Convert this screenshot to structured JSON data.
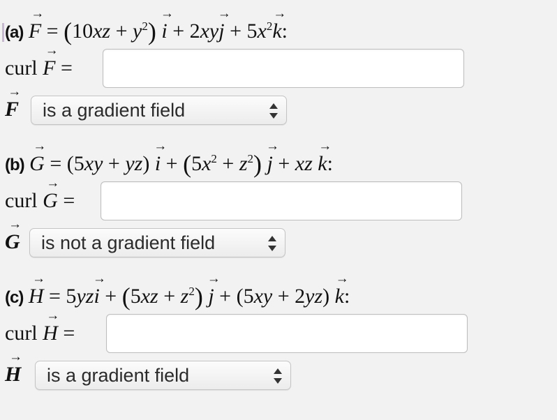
{
  "parts": [
    {
      "label": "(a)",
      "field_letter": "F",
      "curl_prefix": "curl",
      "curl_equals": "=",
      "answer_value": "",
      "selected": "is a gradient field"
    },
    {
      "label": "(b)",
      "field_letter": "G",
      "curl_prefix": "curl",
      "curl_equals": "=",
      "answer_value": "",
      "selected": "is not a gradient field"
    },
    {
      "label": "(c)",
      "field_letter": "H",
      "curl_prefix": "curl",
      "curl_equals": "=",
      "answer_value": "",
      "selected": "is a gradient field"
    }
  ]
}
